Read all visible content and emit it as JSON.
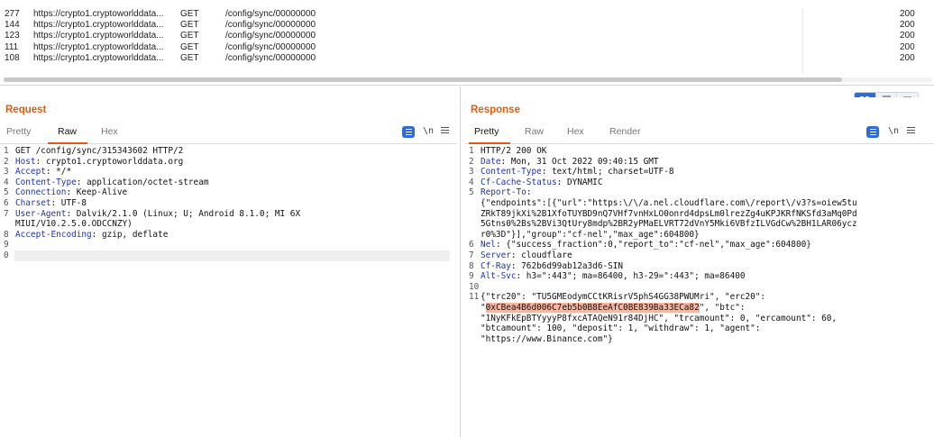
{
  "history": {
    "rows": [
      {
        "id": "277",
        "host": "https://crypto1.cryptoworlddata...",
        "method": "GET",
        "path": "/config/sync/00000000",
        "status": "200"
      },
      {
        "id": "144",
        "host": "https://crypto1.cryptoworlddata...",
        "method": "GET",
        "path": "/config/sync/00000000",
        "status": "200"
      },
      {
        "id": "123",
        "host": "https://crypto1.cryptoworlddata...",
        "method": "GET",
        "path": "/config/sync/00000000",
        "status": "200"
      },
      {
        "id": "111",
        "host": "https://crypto1.cryptoworlddata...",
        "method": "GET",
        "path": "/config/sync/00000000",
        "status": "200"
      },
      {
        "id": "108",
        "host": "https://crypto1.cryptoworlddata...",
        "method": "GET",
        "path": "/config/sync/00000000",
        "status": "200"
      }
    ]
  },
  "request": {
    "title": "Request",
    "tabs": [
      "Pretty",
      "Raw",
      "Hex"
    ],
    "active_tab": "Raw",
    "newline_toggle": "\\n",
    "lines": [
      {
        "n": "1",
        "text": "GET /config/sync/315343602 HTTP/2"
      },
      {
        "n": "2",
        "key": "Host",
        "val": " crypto1.cryptoworlddata.org"
      },
      {
        "n": "3",
        "key": "Accept",
        "val": " */*"
      },
      {
        "n": "4",
        "key": "Content-Type",
        "val": " application/octet-stream"
      },
      {
        "n": "5",
        "key": "Connection",
        "val": " Keep-Alive"
      },
      {
        "n": "6",
        "key": "Charset",
        "val": " UTF-8"
      },
      {
        "n": "7",
        "key": "User-Agent",
        "val": " Dalvik/2.1.0 (Linux; U; Android 8.1.0; MI 6X"
      },
      {
        "n": "",
        "text": "MIUI/V10.2.5.0.ODCCNZY)"
      },
      {
        "n": "8",
        "key": "Accept-Encoding",
        "val": " gzip, deflate"
      },
      {
        "n": "9",
        "text": ""
      },
      {
        "n": "0",
        "text": ""
      }
    ]
  },
  "response": {
    "title": "Response",
    "tabs": [
      "Pretty",
      "Raw",
      "Hex",
      "Render"
    ],
    "active_tab": "Pretty",
    "newline_toggle": "\\n",
    "lines": [
      {
        "n": "1",
        "text": "HTTP/2 200 OK"
      },
      {
        "n": "2",
        "key": "Date",
        "val": " Mon, 31 Oct 2022 09:40:15 GMT"
      },
      {
        "n": "3",
        "key": "Content-Type",
        "val": " text/html; charset=UTF-8"
      },
      {
        "n": "4",
        "key": "Cf-Cache-Status",
        "val": " DYNAMIC"
      },
      {
        "n": "5",
        "key": "Report-To",
        "val": ""
      },
      {
        "n": "",
        "text": "{\"endpoints\":[{\"url\":\"https:\\/\\/a.nel.cloudflare.com\\/report\\/v3?s=oiew5tu"
      },
      {
        "n": "",
        "text": "ZRkT89jkXi%2B1XfoTUYBD9nQ7VHf7vnHxLO0onrd4dpsLm0lrezZg4uKPJKRfNKSfd3aMq0Pd"
      },
      {
        "n": "",
        "text": "5Gtns0%2Bs%2BVi3QtUry8mdp%2BR2yPMaELVRT72dVnY5Mki6VBfzILVGdCw%2BH1LAR06ycz"
      },
      {
        "n": "",
        "text": "r0%3D\"}],\"group\":\"cf-nel\",\"max_age\":604800}"
      },
      {
        "n": "6",
        "key": "Nel",
        "val": " {\"success_fraction\":0,\"report_to\":\"cf-nel\",\"max_age\":604800}"
      },
      {
        "n": "7",
        "key": "Server",
        "val": " cloudflare"
      },
      {
        "n": "8",
        "key": "Cf-Ray",
        "val": " 762b6d99ab12a3d6-SIN"
      },
      {
        "n": "9",
        "key": "Alt-Svc",
        "val": " h3=\":443\"; ma=86400, h3-29=\":443\"; ma=86400"
      },
      {
        "n": "10",
        "text": ""
      },
      {
        "n": "11",
        "text": "{\"trc20\": \"TU5GMEodymCCtKRisrV5phS4GG38PWUMri\", \"erc20\":"
      },
      {
        "n": "",
        "pre": "\"",
        "hl": "0xCBea4B6d006C7eb5b0B8EeAfC0BE839Ba33ECa82",
        "post": "\", \"btc\":"
      },
      {
        "n": "",
        "text": "\"1NyKFkEpBTYyyyP8fxcATAQeN91r84DjHC\", \"trcamount\": 0, \"ercamount\": 60,"
      },
      {
        "n": "",
        "text": "\"btcamount\": 100, \"deposit\": 1, \"withdraw\": 1, \"agent\":"
      },
      {
        "n": "",
        "text": "\"https://www.Binance.com\"}"
      }
    ]
  }
}
